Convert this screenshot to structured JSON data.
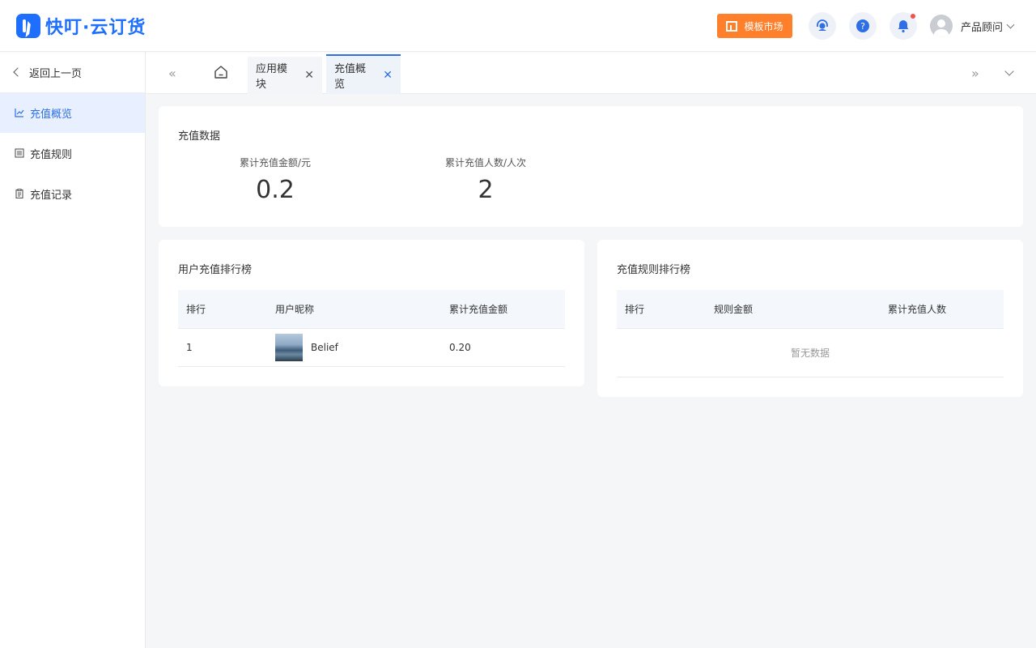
{
  "header": {
    "logo_text": "快叮·云订货",
    "template_market": "模板市场",
    "user_name": "产品顾问"
  },
  "sidebar": {
    "back_label": "返回上一页",
    "items": [
      {
        "label": "充值概览",
        "icon": "chart-icon",
        "active": true
      },
      {
        "label": "充值规则",
        "icon": "list-icon"
      },
      {
        "label": "充值记录",
        "icon": "clipboard-icon"
      }
    ]
  },
  "tabs": [
    {
      "label": "应用模块"
    },
    {
      "label": "充值概览",
      "active": true
    }
  ],
  "recharge_data": {
    "title": "充值数据",
    "stats": [
      {
        "label": "累计充值金额/元",
        "value": "0.2"
      },
      {
        "label": "累计充值人数/人次",
        "value": "2"
      }
    ]
  },
  "user_ranking": {
    "title": "用户充值排行榜",
    "columns": [
      "排行",
      "用户昵称",
      "累计充值金额"
    ],
    "rows": [
      {
        "rank": "1",
        "nickname": "Belief",
        "amount": "0.20"
      }
    ]
  },
  "rule_ranking": {
    "title": "充值规则排行榜",
    "columns": [
      "排行",
      "规则金额",
      "累计充值人数"
    ],
    "empty_text": "暂无数据"
  }
}
